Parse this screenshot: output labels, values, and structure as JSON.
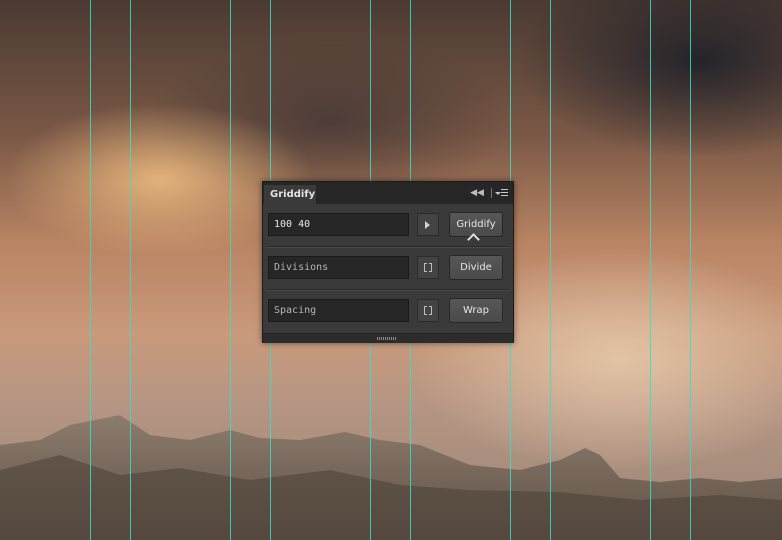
{
  "panel": {
    "title": "Griddify",
    "rows": [
      {
        "input_value": "100 40",
        "input_placeholder": "",
        "button_label": "Griddify"
      },
      {
        "input_value": "",
        "input_placeholder": "Divisions",
        "button_label": "Divide"
      },
      {
        "input_value": "",
        "input_placeholder": "Spacing",
        "button_label": "Wrap"
      }
    ]
  },
  "icons": {
    "collapse": "double-chevron-left-icon",
    "menu": "flyout-menu-icon",
    "run": "play-arrow-icon",
    "bracket": "bracket-icon",
    "resize": "resize-grip-icon"
  },
  "colors": {
    "guide": "#34e0c8",
    "panel_bg": "#3a3a3a",
    "header_bg": "#262626",
    "field_bg": "#262626",
    "button_bg": "#4f4f4f"
  }
}
